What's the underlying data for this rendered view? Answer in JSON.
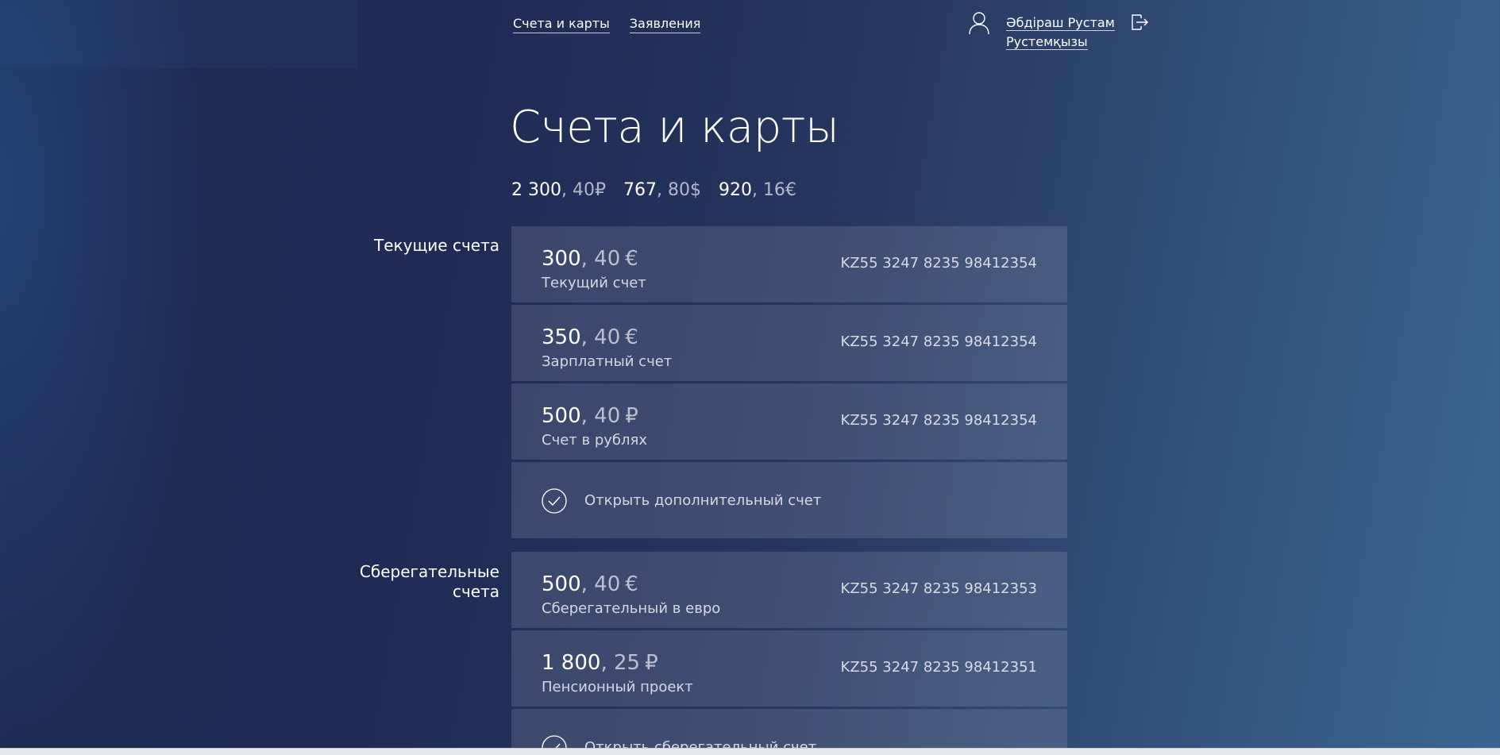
{
  "header": {
    "nav": [
      {
        "label": "Счета и карты"
      },
      {
        "label": "Заявления"
      }
    ],
    "user": {
      "name_line1": "Әбдіраш Рустам",
      "name_line2": "Рустемқызы"
    },
    "icons": {
      "user": "user-icon",
      "logout": "logout-icon"
    }
  },
  "page": {
    "title": "Счета и карты",
    "totals": [
      {
        "main": "2 300",
        "frac": ", 40",
        "currency": "₽"
      },
      {
        "main": "767",
        "frac": ", 80",
        "currency": "$"
      },
      {
        "main": "920",
        "frac": ", 16",
        "currency": "€"
      }
    ]
  },
  "current_accounts": {
    "label": "Текущие счета",
    "items": [
      {
        "int": "300",
        "frac": "40",
        "currency": "€",
        "name": "Текущий счет",
        "iban": "KZ55 3247 8235 98412354"
      },
      {
        "int": "350",
        "frac": "40",
        "currency": "€",
        "name": "Зарплатный счет",
        "iban": "KZ55 3247 8235 98412354"
      },
      {
        "int": "500",
        "frac": "40",
        "currency": "₽",
        "name": "Счет в рублях",
        "iban": "KZ55 3247 8235 98412354"
      }
    ],
    "action": "Открыть дополнительный счет"
  },
  "savings_accounts": {
    "label_line1": "Сберегательные",
    "label_line2": "счета",
    "items": [
      {
        "int": "500",
        "frac": "40",
        "currency": "€",
        "name": "Сберегательный в евро",
        "iban": "KZ55 3247 8235 98412353"
      },
      {
        "int": "1 800",
        "frac": "25",
        "currency": "₽",
        "name": "Пенсионный проект",
        "iban": "KZ55 3247 8235 98412351"
      }
    ],
    "action": "Открыть сберегательный счет"
  },
  "colors": {
    "background_start": "#1d2c54",
    "background_end": "#3a6590",
    "card_background": "rgba(255,255,255,0.12)"
  }
}
